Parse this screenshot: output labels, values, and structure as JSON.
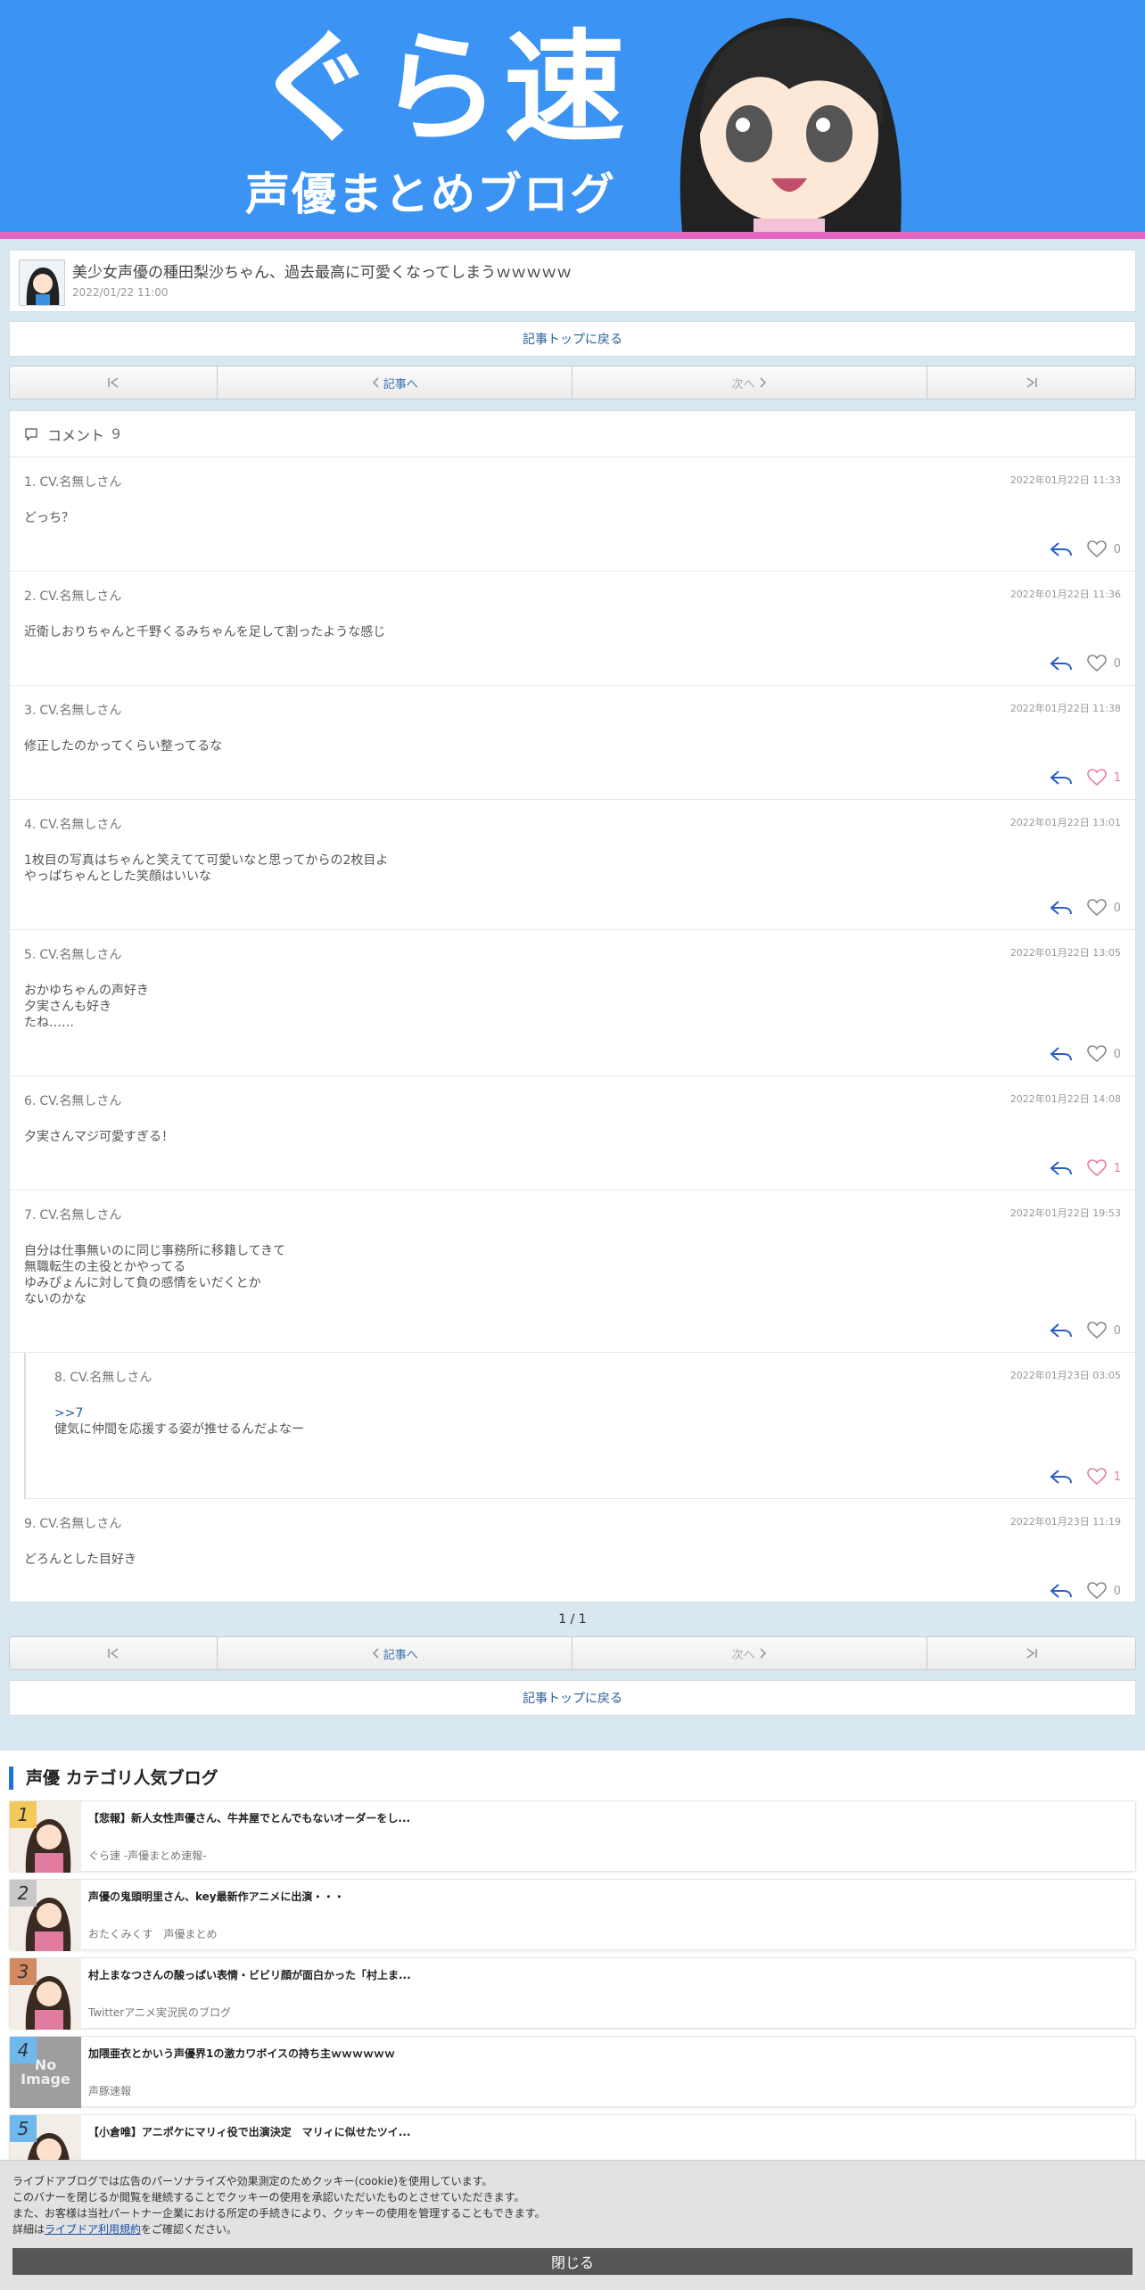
{
  "header": {
    "logo_main": "ぐら速",
    "logo_sub": "声優まとめブログ"
  },
  "article": {
    "title": "美少女声優の種田梨沙ちゃん、過去最高に可愛くなってしまうｗｗｗｗｗ",
    "date": "2022/01/22 11:00"
  },
  "nav": {
    "back_to_top": "記事トップに戻る",
    "first": "|<",
    "prev": "記事へ",
    "next": "次へ",
    "last": ">|"
  },
  "comments": {
    "label": "コメント",
    "count": "9",
    "items": [
      {
        "num": "1.",
        "name": "CV.名無しさん",
        "time": "2022年01月22日 11:33",
        "body": "どっち？",
        "likes": "0"
      },
      {
        "num": "2.",
        "name": "CV.名無しさん",
        "time": "2022年01月22日 11:36",
        "body": "近衛しおりちゃんと千野くるみちゃんを足して割ったような感じ",
        "likes": "0"
      },
      {
        "num": "3.",
        "name": "CV.名無しさん",
        "time": "2022年01月22日 11:38",
        "body": "修正したのかってくらい整ってるな",
        "likes": "1"
      },
      {
        "num": "4.",
        "name": "CV.名無しさん",
        "time": "2022年01月22日 13:01",
        "body": "1枚目の写真はちゃんと笑えてて可愛いなと思ってからの2枚目よ\nやっぱちゃんとした笑顔はいいな",
        "likes": "0"
      },
      {
        "num": "5.",
        "name": "CV.名無しさん",
        "time": "2022年01月22日 13:05",
        "body": "おかゆちゃんの声好き\n夕実さんも好き\nたね……",
        "likes": "0"
      },
      {
        "num": "6.",
        "name": "CV.名無しさん",
        "time": "2022年01月22日 14:08",
        "body": "夕実さんマジ可愛すぎる！",
        "likes": "1"
      },
      {
        "num": "7.",
        "name": "CV.名無しさん",
        "time": "2022年01月22日 19:53",
        "body": "自分は仕事無いのに同じ事務所に移籍してきて\n無職転生の主役とかやってる\nゆみぴょんに対して負の感情をいだくとか\nないのかな",
        "likes": "0"
      },
      {
        "num": "8.",
        "name": "CV.名無しさん",
        "time": "2022年01月23日 03:05",
        "anchor": ">>7",
        "body": "健気に仲間を応援する姿が推せるんだよなー",
        "likes": "1"
      },
      {
        "num": "9.",
        "name": "CV.名無しさん",
        "time": "2022年01月23日 11:19",
        "body": "どろんとした目好き",
        "likes": "0"
      }
    ]
  },
  "pagination": {
    "label": "1 / 1"
  },
  "popular": {
    "title": "声優 カテゴリ人気ブログ",
    "items": [
      {
        "rank": "1",
        "headline": "【悲報】新人女性声優さん、牛丼屋でとんでもないオーダーをし...",
        "source": "ぐら速 -声優まとめ速報-",
        "rank_color": "#f5c85a"
      },
      {
        "rank": "2",
        "headline": "声優の鬼頭明里さん、key最新作アニメに出演・・・",
        "source": "おたくみくす　声優まとめ",
        "rank_color": "#c8c8c8"
      },
      {
        "rank": "3",
        "headline": "村上まなつさんの酸っぱい表情・ビビリ顔が面白かった「村上ま...",
        "source": "Twitterアニメ実況民のブログ",
        "rank_color": "#d28a63"
      },
      {
        "rank": "4",
        "headline": "加隈亜衣とかいう声優界1の激カワボイスの持ち主ｗｗｗｗｗｗ",
        "source": "声豚速報",
        "rank_color": "#6fb8ec",
        "no_image": "No Image"
      },
      {
        "rank": "5",
        "headline": "【小倉唯】アニポケにマリィ役で出演決定　マリィに似せたツイ...",
        "source": "",
        "rank_color": "#6fb8ec"
      }
    ]
  },
  "cookie": {
    "line1": "ライブドアブログでは広告のパーソナライズや効果測定のためクッキー(cookie)を使用しています。",
    "line2": "このバナーを閉じるか閲覧を継続することでクッキーの使用を承認いただいたものとさせていただきます。",
    "line3": "また、お客様は当社パートナー企業における所定の手続きにより、クッキーの使用を管理することもできます。",
    "line4_pre": "詳細は",
    "line4_link": "ライブドア利用規約",
    "line4_post": "をご確認ください。",
    "close": "閉じる"
  },
  "colors": {
    "accent": "#3b93f3",
    "stripe": "#e066c0",
    "link": "#2a5e9c",
    "like": "#e47ba6",
    "reply_arrow": "#2a5ec0"
  }
}
